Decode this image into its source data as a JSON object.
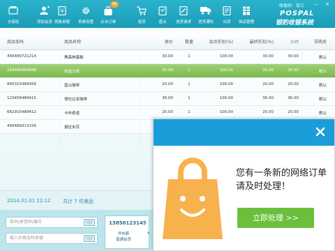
{
  "toolbar": {
    "items": [
      {
        "label": "交接班",
        "icon": "handover-icon"
      },
      {
        "label": "添加会员",
        "icon": "add-member-icon"
      },
      {
        "label": "销售单据",
        "icon": "sales-receipt-icon"
      },
      {
        "label": "系统设置",
        "icon": "gear-icon"
      },
      {
        "label": "点击订单",
        "icon": "bag-icon",
        "badge": "99"
      },
      {
        "label": "退货",
        "icon": "cart-return-icon"
      },
      {
        "label": "盘点",
        "icon": "inventory-icon"
      },
      {
        "label": "进货请求",
        "icon": "purchase-request-icon"
      },
      {
        "label": "进货通知",
        "icon": "truck-icon"
      },
      {
        "label": "出货",
        "icon": "stock-out-icon"
      },
      {
        "label": "商品管理",
        "icon": "product-manage-icon"
      }
    ],
    "cashier": "收银员：张三",
    "window_buttons": {
      "minimize": "—",
      "close": "×"
    },
    "logo_en": "POSPAL",
    "logo_cn": "银豹收银系统"
  },
  "table": {
    "headers": {
      "code": "商品条码",
      "name": "商品名称",
      "price": "原价",
      "qty": "数量",
      "member_price": "会员折扣(%)",
      "discount": "最终折扣(%)",
      "subtotal": "小计",
      "guide": "导购员"
    },
    "rows": [
      {
        "code": "456489721214",
        "name": "黑森林蛋糕",
        "price": "30.00",
        "qty": "1",
        "member_price": "100.00",
        "discount": "30.00",
        "subtotal": "30.00",
        "guide": "默认",
        "selected": false
      },
      {
        "code": "156486484898",
        "name": "凯星大奇",
        "price": "35.00",
        "qty": "1",
        "member_price": "100.00",
        "discount": "35.00",
        "subtotal": "35.00",
        "guide": "默认",
        "selected": true
      },
      {
        "code": "845315489456",
        "name": "蓝山咖啡",
        "price": "20.00",
        "qty": "1",
        "member_price": "100.00",
        "discount": "20.00",
        "subtotal": "20.00",
        "guide": "默认",
        "selected": false
      },
      {
        "code": "123456489415",
        "name": "哥伦比亚咖啡",
        "price": "36.00",
        "qty": "1",
        "member_price": "100.00",
        "discount": "36.00",
        "subtotal": "36.00",
        "guide": "默认",
        "selected": false
      },
      {
        "code": "662915489412",
        "name": "卡布奇诺",
        "price": "25.00",
        "qty": "1",
        "member_price": "100.00",
        "discount": "25.00",
        "subtotal": "25.00",
        "guide": "默认",
        "selected": false
      },
      {
        "code": "456489313156",
        "name": "拔拉米苏",
        "price": "",
        "qty": "",
        "member_price": "",
        "discount": "",
        "subtotal": "",
        "guide": "",
        "selected": false
      }
    ]
  },
  "summary": {
    "datetime": "2014.01.01 12:12",
    "total": "共计 7 件商品"
  },
  "bottom": {
    "search_placeholder": "条码/拼音码/编号",
    "price_placeholder": "输入价格无码收银",
    "phone": "13850123145",
    "member_tag": "乔布斯",
    "member_tag2": "普通会员",
    "yen": "¥"
  },
  "popup": {
    "message": "您有一条新的网络订单请及时处理！",
    "button": "立即处理 >>",
    "colors": {
      "header": "#1a9dd9",
      "button": "#6bbf3b",
      "bag": "#f7b24e"
    }
  }
}
